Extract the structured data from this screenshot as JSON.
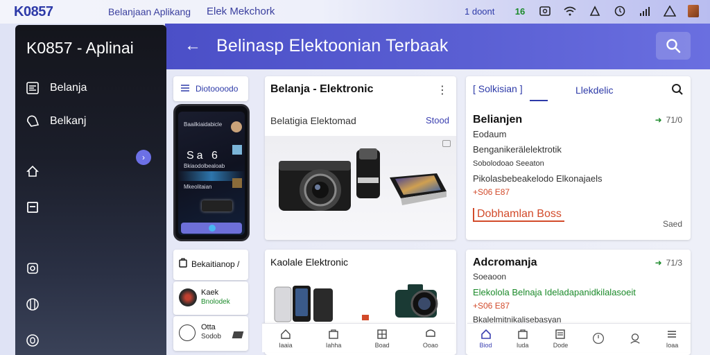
{
  "statusbar": {
    "logo": "K0857",
    "tab1": "Belanjaan Aplikang",
    "tab2": "Elek Mekchork",
    "count": "1 doont",
    "signal_label": "16",
    "icons": [
      "data-icon",
      "screen-icon",
      "wifi-icon",
      "alert-icon",
      "clock-icon",
      "signal-bars-icon",
      "warning-icon",
      "avatar"
    ]
  },
  "header": {
    "title": "Belinasp  Elektoonian  Terbaak"
  },
  "sidebar": {
    "title": "K0857 - Aplinai",
    "items": [
      {
        "label": "Belanja",
        "icon": "list-icon"
      },
      {
        "label": "Belkanj",
        "icon": "tag-icon"
      },
      {
        "label": "",
        "icon": "home-icon"
      },
      {
        "label": "",
        "icon": "box-icon"
      },
      {
        "label": "",
        "icon": "camera-icon"
      },
      {
        "label": "",
        "icon": "grid-icon"
      },
      {
        "label": "",
        "icon": "profile-icon"
      }
    ],
    "badge": "›"
  },
  "left_column": {
    "filter_label": "Diotoooodo",
    "phone": {
      "line1": "Baailkiaidabicle",
      "big": "Sa  6",
      "line2": "Bkiaodolbealoab",
      "line3": "Mkeolitaian"
    },
    "mini1": {
      "title": "Bekaitianop /"
    },
    "mini2": {
      "name": "Kaek",
      "sub": "Bnolodek"
    },
    "mini3": {
      "name": "Otta",
      "sub": "Sodob"
    }
  },
  "center_card": {
    "title": "Belanja - Elektronic",
    "subtitle": "Belatigia Elektomad",
    "link": "Stood"
  },
  "center_card2": {
    "title": "Kaolale Elektronic"
  },
  "right_card": {
    "tab1": "Solkisian",
    "tab2": "Llekdelic",
    "heading": "Belianjen",
    "rating": "71/0",
    "lines": [
      "Eodaum",
      "Benganikerälelektrotik",
      "Sobolodoao Seeaton",
      "Pikolasbebeakelodo Elkonajaels"
    ],
    "price": "+S06 E87",
    "promo": "Dobhamlan",
    "promo_rest": "Boss",
    "foot": "Saed"
  },
  "right_card2": {
    "heading": "Adcromanja",
    "rating": "71/3",
    "line1": "Soeaoon",
    "line2": "Elekolola Belnaja Ideladapanidkilalasoeit",
    "price": "+S06 E87",
    "line3": "Bkalelmitnikalisebasyan"
  },
  "navbar_center": [
    {
      "label": "Iaaia",
      "icon": "home-icon"
    },
    {
      "label": "Iahha",
      "icon": "bag-icon"
    },
    {
      "label": "Boad",
      "icon": "grid-icon"
    },
    {
      "label": "Ooao",
      "icon": "message-icon"
    }
  ],
  "navbar_right": [
    {
      "label": "Biod",
      "icon": "home-icon",
      "active": true
    },
    {
      "label": "Iuda",
      "icon": "bag-icon"
    },
    {
      "label": "Dode",
      "icon": "list-icon"
    },
    {
      "label": "",
      "icon": "clock-icon"
    },
    {
      "label": "",
      "icon": "user-icon"
    },
    {
      "label": "Ioaa",
      "icon": "menu-icon"
    }
  ],
  "colors": {
    "accent": "#5458cf",
    "sidebar": "#14151c",
    "promo": "#d24a2a",
    "positive": "#1b8a2a"
  }
}
